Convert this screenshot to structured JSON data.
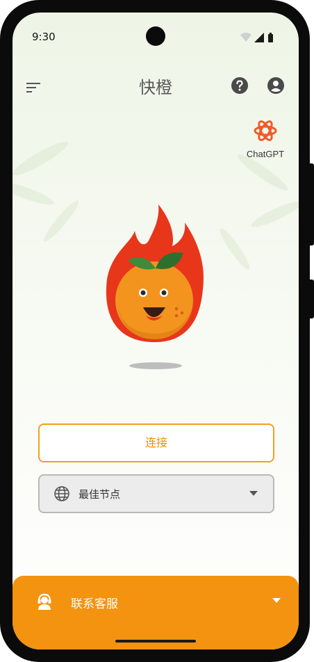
{
  "status_bar": {
    "time": "9:30"
  },
  "app_bar": {
    "title": "快橙"
  },
  "chatgpt_shortcut": {
    "label": "ChatGPT"
  },
  "connect": {
    "label": "连接"
  },
  "node_selector": {
    "selected": "最佳节点"
  },
  "contact": {
    "label": "联系客服"
  },
  "colors": {
    "accent": "#f39310",
    "connect_border": "#f0a020",
    "chatgpt_brand": "#f05a28"
  },
  "icons": [
    "menu-icon",
    "help-icon",
    "account-icon",
    "chatgpt-logo-icon",
    "globe-icon",
    "chevron-down-icon",
    "headset-icon"
  ]
}
